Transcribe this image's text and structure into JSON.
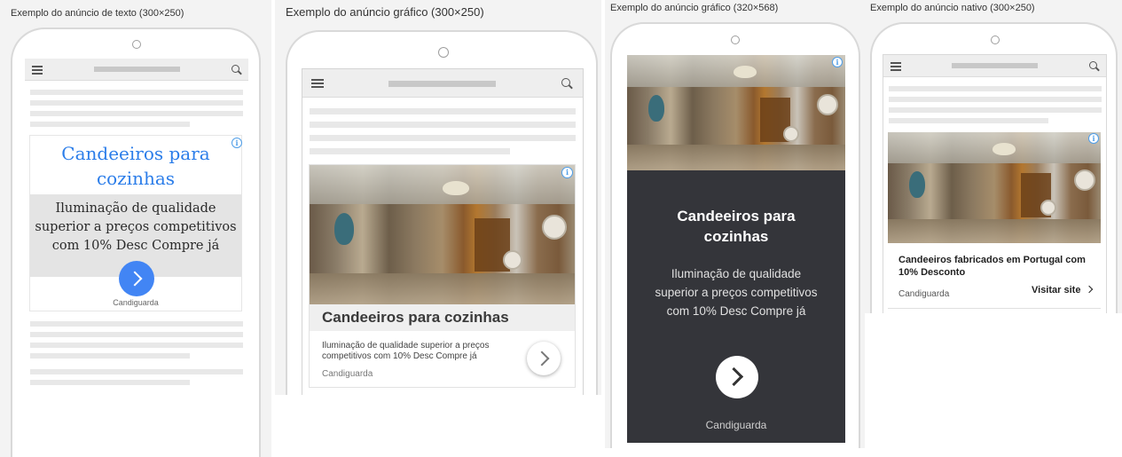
{
  "captions": {
    "text_ad": "Exemplo do anúncio de texto (300×250)",
    "image_ad": "Exemplo do anúncio gráfico (300×250)",
    "image_ad_tall": "Exemplo do anúncio gráfico (320×568)",
    "native_ad": "Exemplo do anúncio nativo (300×250)"
  },
  "ad": {
    "headline": "Candeeiros para cozinhas",
    "headline_line1": "Candeeiros para",
    "headline_line2": "cozinhas",
    "description": "Iluminação de qualidade superior a preços competitivos com 10% Desc Compre já",
    "description_lines_text": [
      "Iluminação de qualidade",
      "superior a preços competitivos",
      "com 10% Desc Compre já"
    ],
    "description_lines_image": [
      "Iluminação de qualidade superior a preços",
      "competitivos com 10% Desc Compre já"
    ],
    "description_lines_tall": [
      "Iluminação de qualidade",
      "superior a preços competitivos",
      "com 10% Desc Compre já"
    ],
    "advertiser": "Candiguarda",
    "info_icon": "i",
    "native_headline_lines": [
      "Candeeiros fabricados em Portugal com",
      "10% Desconto"
    ],
    "visit_site": "Visitar site",
    "accent_color": "#4285f4"
  }
}
